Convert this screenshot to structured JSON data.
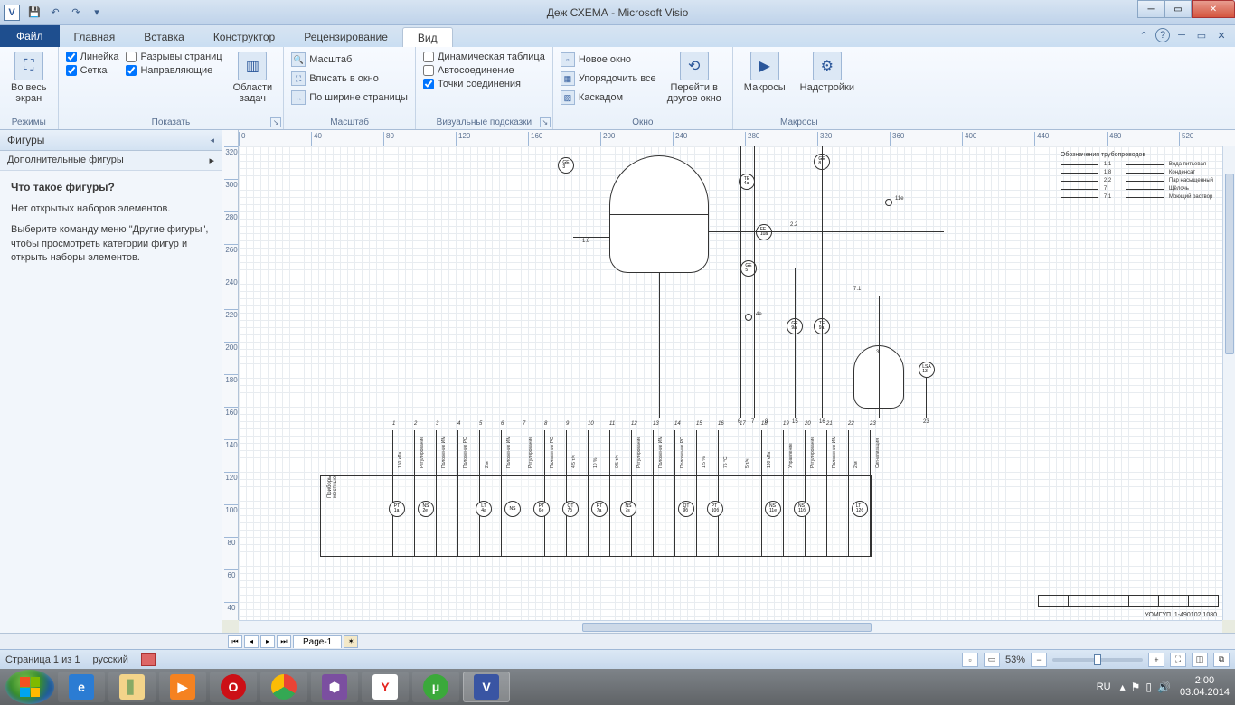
{
  "title": "Деж СХЕМА  -  Microsoft Visio",
  "visio_letter": "V",
  "tabs": {
    "file": "Файл",
    "home": "Главная",
    "insert": "Вставка",
    "designer": "Конструктор",
    "review": "Рецензирование",
    "view": "Вид"
  },
  "ribbon": {
    "modes": {
      "fullscreen": "Во весь\nэкран",
      "label": "Режимы"
    },
    "show": {
      "ruler": "Линейка",
      "pagebreaks": "Разрывы страниц",
      "grid": "Сетка",
      "guides": "Направляющие",
      "taskpanes": "Области\nзадач",
      "label": "Показать"
    },
    "zoom": {
      "zoom": "Масштаб",
      "fitwindow": "Вписать в окно",
      "pagewidth": "По ширине страницы",
      "label": "Масштаб"
    },
    "visual": {
      "dyntable": "Динамическая таблица",
      "autoconnect": "Автосоединение",
      "connpoints": "Точки соединения",
      "label": "Визуальные подсказки"
    },
    "window": {
      "newwin": "Новое окно",
      "arrange": "Упорядочить все",
      "cascade": "Каскадом",
      "switch": "Перейти в\nдругое окно",
      "label": "Окно"
    },
    "macros": {
      "macros": "Макросы",
      "addins": "Надстройки",
      "label": "Макросы"
    }
  },
  "shapes_panel": {
    "header": "Фигуры",
    "more": "Дополнительные фигуры",
    "title": "Что такое фигуры?",
    "p1": "Нет открытых наборов элементов.",
    "p2": "Выберите команду меню \"Другие фигуры\", чтобы просмотреть категории фигур и открыть наборы элементов."
  },
  "ruler_h": [
    "0",
    "40",
    "80",
    "120",
    "160",
    "200",
    "240",
    "280",
    "320",
    "360",
    "400",
    "440",
    "480",
    "520"
  ],
  "ruler_v": [
    "320",
    "300",
    "280",
    "260",
    "240",
    "220",
    "200",
    "180",
    "160",
    "140",
    "120",
    "100",
    "80",
    "60",
    "40"
  ],
  "legend": {
    "title": "Обозначения трубопроводов",
    "rows": [
      {
        "code": "1.1",
        "name": "Вода питьевая"
      },
      {
        "code": "1.8",
        "name": "Конденсат"
      },
      {
        "code": "2.2",
        "name": "Пар насыщенный"
      },
      {
        "code": "7",
        "name": "Щёлочь"
      },
      {
        "code": "7.1",
        "name": "Моющий раствор"
      }
    ]
  },
  "pipe_labels": {
    "l18": "1.8",
    "l22": "2.2",
    "l71": "7.1",
    "l4e": "4e",
    "l11e": "11e"
  },
  "bottom_nums": [
    "6",
    "7",
    "8",
    "15",
    "16",
    "23"
  ],
  "col_nums": [
    "1",
    "2",
    "3",
    "4",
    "5",
    "6",
    "7",
    "8",
    "9",
    "10",
    "11",
    "12",
    "13",
    "14",
    "15",
    "16",
    "17",
    "18",
    "19",
    "20",
    "21",
    "22",
    "23"
  ],
  "col_labels": [
    "150 кПа",
    "Регулирование",
    "Положение ИМ",
    "Положение РО",
    "2 м",
    "Положение ИМ",
    "Регулирование",
    "Положение РО",
    "4,5 т/ч",
    "10 %",
    "0,5 т/ч",
    "Регулирование",
    "Положение ИМ",
    "Положение РО",
    "1,5 %",
    "75 °C",
    "5 т/ч",
    "160 кПа",
    "Управление",
    "Регулирование",
    "Положение ИМ",
    "2 м",
    "Сигнализация"
  ],
  "side_label": "Приборы\nместные",
  "instrument_tags": [
    "PT 1a",
    "NS 2e",
    "",
    "LT 4a",
    "NS",
    "PT 6e",
    "QT 7б",
    "PT 7a",
    "NS 7s",
    "",
    "QT 9б",
    "PT 10б",
    "",
    "NS 11e",
    "NS 11б",
    "",
    "LT 12б",
    ""
  ],
  "drawing_code": "УОМГУП. 1-490102.1080",
  "page_tab": "Page-1",
  "status": {
    "page": "Страница 1 из 1",
    "lang": "русский",
    "zoom": "53%",
    "kbd": "RU",
    "time": "2:00",
    "date": "03.04.2014"
  }
}
